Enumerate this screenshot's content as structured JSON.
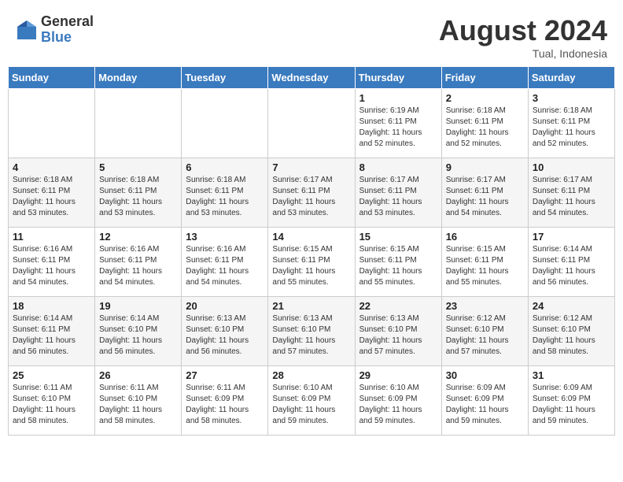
{
  "logo": {
    "general": "General",
    "blue": "Blue"
  },
  "title": "August 2024",
  "location": "Tual, Indonesia",
  "weekdays": [
    "Sunday",
    "Monday",
    "Tuesday",
    "Wednesday",
    "Thursday",
    "Friday",
    "Saturday"
  ],
  "weeks": [
    [
      {
        "day": "",
        "info": ""
      },
      {
        "day": "",
        "info": ""
      },
      {
        "day": "",
        "info": ""
      },
      {
        "day": "",
        "info": ""
      },
      {
        "day": "1",
        "info": "Sunrise: 6:19 AM\nSunset: 6:11 PM\nDaylight: 11 hours\nand 52 minutes."
      },
      {
        "day": "2",
        "info": "Sunrise: 6:18 AM\nSunset: 6:11 PM\nDaylight: 11 hours\nand 52 minutes."
      },
      {
        "day": "3",
        "info": "Sunrise: 6:18 AM\nSunset: 6:11 PM\nDaylight: 11 hours\nand 52 minutes."
      }
    ],
    [
      {
        "day": "4",
        "info": "Sunrise: 6:18 AM\nSunset: 6:11 PM\nDaylight: 11 hours\nand 53 minutes."
      },
      {
        "day": "5",
        "info": "Sunrise: 6:18 AM\nSunset: 6:11 PM\nDaylight: 11 hours\nand 53 minutes."
      },
      {
        "day": "6",
        "info": "Sunrise: 6:18 AM\nSunset: 6:11 PM\nDaylight: 11 hours\nand 53 minutes."
      },
      {
        "day": "7",
        "info": "Sunrise: 6:17 AM\nSunset: 6:11 PM\nDaylight: 11 hours\nand 53 minutes."
      },
      {
        "day": "8",
        "info": "Sunrise: 6:17 AM\nSunset: 6:11 PM\nDaylight: 11 hours\nand 53 minutes."
      },
      {
        "day": "9",
        "info": "Sunrise: 6:17 AM\nSunset: 6:11 PM\nDaylight: 11 hours\nand 54 minutes."
      },
      {
        "day": "10",
        "info": "Sunrise: 6:17 AM\nSunset: 6:11 PM\nDaylight: 11 hours\nand 54 minutes."
      }
    ],
    [
      {
        "day": "11",
        "info": "Sunrise: 6:16 AM\nSunset: 6:11 PM\nDaylight: 11 hours\nand 54 minutes."
      },
      {
        "day": "12",
        "info": "Sunrise: 6:16 AM\nSunset: 6:11 PM\nDaylight: 11 hours\nand 54 minutes."
      },
      {
        "day": "13",
        "info": "Sunrise: 6:16 AM\nSunset: 6:11 PM\nDaylight: 11 hours\nand 54 minutes."
      },
      {
        "day": "14",
        "info": "Sunrise: 6:15 AM\nSunset: 6:11 PM\nDaylight: 11 hours\nand 55 minutes."
      },
      {
        "day": "15",
        "info": "Sunrise: 6:15 AM\nSunset: 6:11 PM\nDaylight: 11 hours\nand 55 minutes."
      },
      {
        "day": "16",
        "info": "Sunrise: 6:15 AM\nSunset: 6:11 PM\nDaylight: 11 hours\nand 55 minutes."
      },
      {
        "day": "17",
        "info": "Sunrise: 6:14 AM\nSunset: 6:11 PM\nDaylight: 11 hours\nand 56 minutes."
      }
    ],
    [
      {
        "day": "18",
        "info": "Sunrise: 6:14 AM\nSunset: 6:11 PM\nDaylight: 11 hours\nand 56 minutes."
      },
      {
        "day": "19",
        "info": "Sunrise: 6:14 AM\nSunset: 6:10 PM\nDaylight: 11 hours\nand 56 minutes."
      },
      {
        "day": "20",
        "info": "Sunrise: 6:13 AM\nSunset: 6:10 PM\nDaylight: 11 hours\nand 56 minutes."
      },
      {
        "day": "21",
        "info": "Sunrise: 6:13 AM\nSunset: 6:10 PM\nDaylight: 11 hours\nand 57 minutes."
      },
      {
        "day": "22",
        "info": "Sunrise: 6:13 AM\nSunset: 6:10 PM\nDaylight: 11 hours\nand 57 minutes."
      },
      {
        "day": "23",
        "info": "Sunrise: 6:12 AM\nSunset: 6:10 PM\nDaylight: 11 hours\nand 57 minutes."
      },
      {
        "day": "24",
        "info": "Sunrise: 6:12 AM\nSunset: 6:10 PM\nDaylight: 11 hours\nand 58 minutes."
      }
    ],
    [
      {
        "day": "25",
        "info": "Sunrise: 6:11 AM\nSunset: 6:10 PM\nDaylight: 11 hours\nand 58 minutes."
      },
      {
        "day": "26",
        "info": "Sunrise: 6:11 AM\nSunset: 6:10 PM\nDaylight: 11 hours\nand 58 minutes."
      },
      {
        "day": "27",
        "info": "Sunrise: 6:11 AM\nSunset: 6:09 PM\nDaylight: 11 hours\nand 58 minutes."
      },
      {
        "day": "28",
        "info": "Sunrise: 6:10 AM\nSunset: 6:09 PM\nDaylight: 11 hours\nand 59 minutes."
      },
      {
        "day": "29",
        "info": "Sunrise: 6:10 AM\nSunset: 6:09 PM\nDaylight: 11 hours\nand 59 minutes."
      },
      {
        "day": "30",
        "info": "Sunrise: 6:09 AM\nSunset: 6:09 PM\nDaylight: 11 hours\nand 59 minutes."
      },
      {
        "day": "31",
        "info": "Sunrise: 6:09 AM\nSunset: 6:09 PM\nDaylight: 11 hours\nand 59 minutes."
      }
    ]
  ]
}
